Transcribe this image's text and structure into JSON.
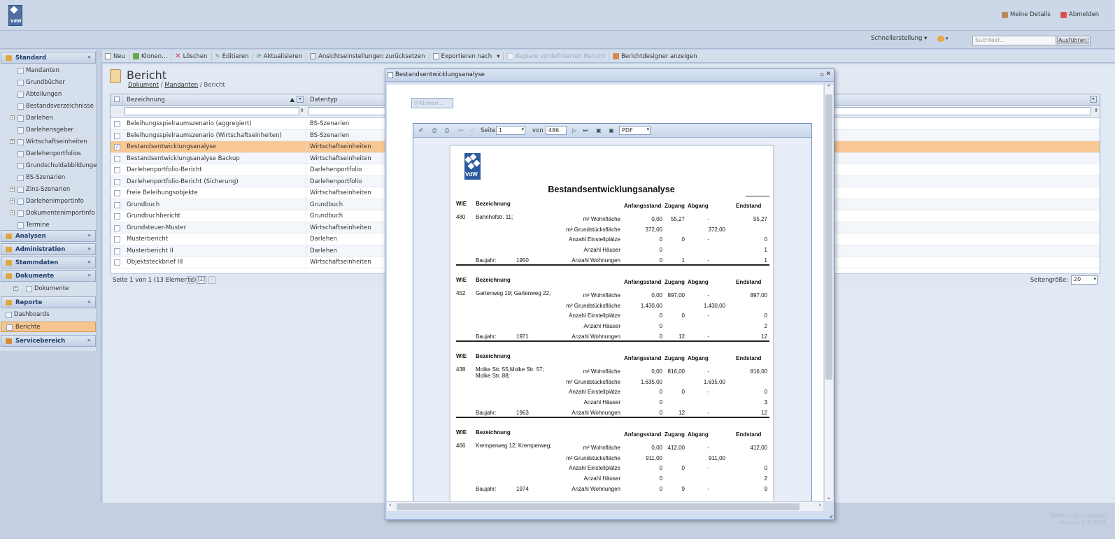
{
  "header": {
    "logo_text": "VdW",
    "my_details": "Meine Details",
    "logout": "Abmelden",
    "quick_settings": "Schnellerstellung",
    "search_placeholder": "Suchtext...",
    "search_button": "Ausführen!"
  },
  "sidebar": {
    "standard": {
      "title": "Standard",
      "items": [
        "Mandanten",
        "Grundbücher",
        "Abteilungen",
        "Bestandsverzeichnisse",
        "Darlehen",
        "Darlehensgeber",
        "Wirtschaftseinheiten",
        "Darlehenportfolios",
        "Grundschuldabbildungen",
        "BS-Szenarien",
        "Zins-Szenarien",
        "Darlehenimportinfo",
        "Dokumentenimportinfo",
        "Termine"
      ]
    },
    "analysen": "Analysen",
    "administration": "Administration",
    "stammdaten": "Stammdaten",
    "dokumente": {
      "title": "Dokumente",
      "items": [
        "Dokumente"
      ]
    },
    "reporte": {
      "title": "Reporte",
      "items": [
        "Dashboards",
        "Berichte"
      ]
    },
    "servicebereich": "Servicebereich"
  },
  "toolbar": {
    "new": "Neu",
    "clone": "Klonen...",
    "delete": "Löschen",
    "edit": "Editieren",
    "refresh": "Aktualisieren",
    "reset_view": "Ansichtseinstellungen zurücksetzen",
    "export": "Exportieren nach",
    "copy_predefined": "Kopiere vordefinierten Bericht",
    "designer": "Berichtdesigner anzeigen"
  },
  "main": {
    "title": "Bericht",
    "breadcrumb": [
      "Dokument",
      "Mandanten",
      "Bericht"
    ],
    "columns": [
      "Bezeichnung",
      "Datentyp"
    ],
    "rows": [
      [
        "Beleihungsspielraumszenario (aggregiert)",
        "BS-Szenarien"
      ],
      [
        "Beleihungsspielraumszenario (Wirtschaftseinheiten)",
        "BS-Szenarien"
      ],
      [
        "Bestandsentwicklungsanalyse",
        "Wirtschaftseinheiten"
      ],
      [
        "Bestandsentwicklungsanalyse Backup",
        "Wirtschaftseinheiten"
      ],
      [
        "Darlehenportfolio-Bericht",
        "Darlehenportfolio"
      ],
      [
        "Darlehenportfolio-Bericht (Sicherung)",
        "Darlehenportfolio"
      ],
      [
        "Freie Beleihungsobjekte",
        "Wirtschaftseinheiten"
      ],
      [
        "Grundbuch",
        "Grundbuch"
      ],
      [
        "Grundbuchbericht",
        "Grundbuch"
      ],
      [
        "Grundsteuer-Muster",
        "Wirtschaftseinheiten"
      ],
      [
        "Musterbericht",
        "Darlehen"
      ],
      [
        "Musterbericht II",
        "Darlehen"
      ],
      [
        "Objektsteckbrief III",
        "Wirtschaftseinheiten"
      ]
    ],
    "pager_text": "Seite 1 von 1 (13 Elemente)",
    "pager_page": "[1]",
    "page_size_label": "Seitengröße:",
    "page_size": "20"
  },
  "dialog": {
    "title": "Bestandsentwicklungsanalyse",
    "clone_button": "Klonen...",
    "viewer": {
      "page_label": "Seite",
      "page_value": "1",
      "of_label": "von",
      "total_pages": "486",
      "format": "PDF"
    },
    "report": {
      "title": "Bestandsentwicklungsanalyse",
      "logo_text": "VdW",
      "hdr": {
        "wie": "WIE",
        "bez": "Bezeichnung",
        "anf": "Anfangsstand",
        "zug": "Zugang",
        "abg": "Abgang",
        "end": "Endstand"
      },
      "labels": {
        "wohn": "m² Wohnfläche",
        "grund": "m² Grundstücksfläche",
        "stell": "Anzahl Einstellplätze",
        "haus": "Anzahl Häuser",
        "wohnungen": "Anzahl Wohnungen",
        "baujahr": "Baujahr:"
      },
      "blocks": [
        {
          "wie": "480",
          "bez": "Bahnhofstr. 11;",
          "bez2": "",
          "baujahr": "1950",
          "wohn": [
            "0,00",
            "55,27",
            "-",
            "55,27"
          ],
          "grund": [
            "372,00",
            "",
            "",
            "372,00"
          ],
          "stell": [
            "0",
            "0",
            "-",
            "0"
          ],
          "haus": [
            "0",
            "",
            "",
            "1"
          ],
          "wohnungen": [
            "0",
            "1",
            "-",
            "1"
          ]
        },
        {
          "wie": "452",
          "bez": "Gartenweg 19; Gartenweg 22;",
          "bez2": "",
          "baujahr": "1971",
          "wohn": [
            "0,00",
            "897,00",
            "-",
            "897,00"
          ],
          "grund": [
            "1.430,00",
            "",
            "",
            "1.430,00"
          ],
          "stell": [
            "0",
            "0",
            "-",
            "0"
          ],
          "haus": [
            "0",
            "",
            "",
            "2"
          ],
          "wohnungen": [
            "0",
            "12",
            "-",
            "12"
          ]
        },
        {
          "wie": "438",
          "bez": "Molke Str. 55;Molke Str. 57;",
          "bez2": "Molke Str. 88;",
          "baujahr": "1963",
          "wohn": [
            "0,00",
            "816,00",
            "-",
            "816,00"
          ],
          "grund": [
            "1.635,00",
            "",
            "",
            "1.635,00"
          ],
          "stell": [
            "0",
            "0",
            "-",
            "0"
          ],
          "haus": [
            "0",
            "",
            "",
            "3"
          ],
          "wohnungen": [
            "0",
            "12",
            "-",
            "12"
          ]
        },
        {
          "wie": "466",
          "bez": "Kremperweg 12; Kremperweg;",
          "bez2": "",
          "baujahr": "1974",
          "wohn": [
            "0,00",
            "412,00",
            "-",
            "412,00"
          ],
          "grund": [
            "911,00",
            "",
            "",
            "911,00"
          ],
          "stell": [
            "0",
            "0",
            "-",
            "0"
          ],
          "haus": [
            "0",
            "",
            "",
            "2"
          ],
          "wohnungen": [
            "0",
            "9",
            "-",
            "9"
          ]
        }
      ]
    }
  },
  "footer": {
    "app_name": "Beleihungsmanager",
    "version": "Version 1.9.3981"
  },
  "colors": {
    "selected_row": "#f8c894",
    "accent": "#2d5a9e",
    "header_bg": "#ccd7e8"
  }
}
